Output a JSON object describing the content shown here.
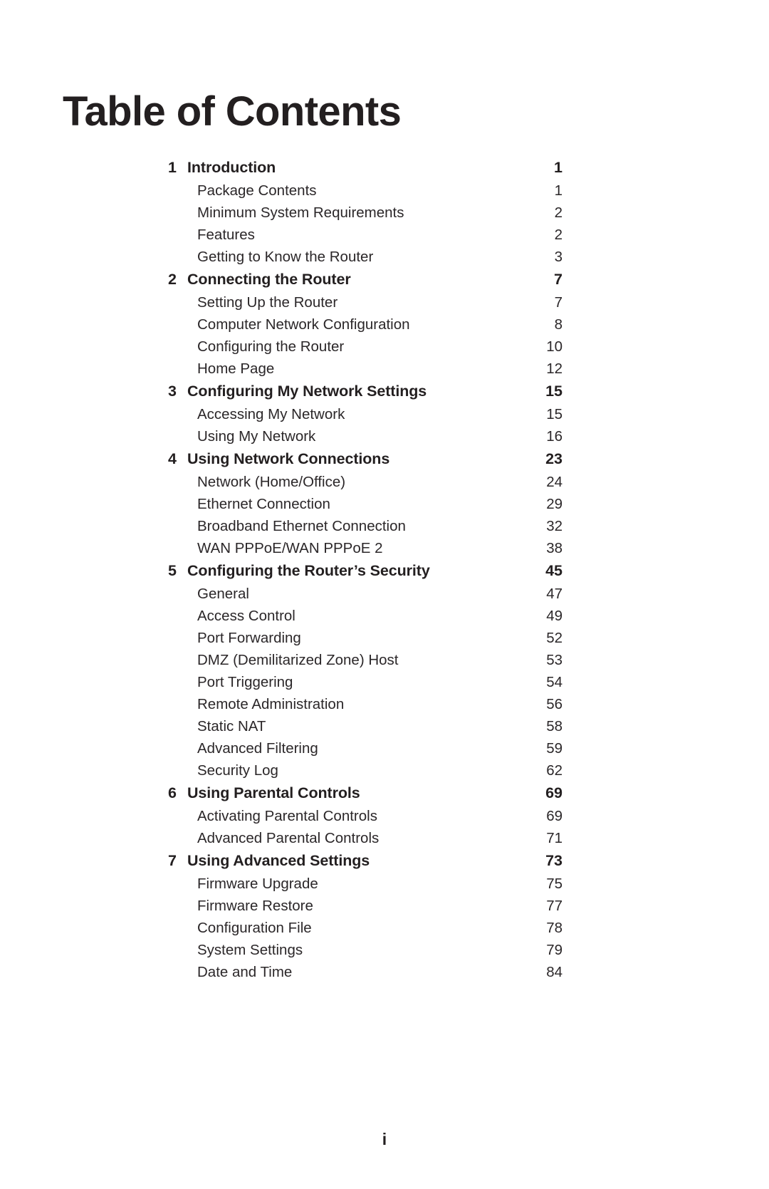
{
  "document": {
    "title": "Table of Contents",
    "folio": "i"
  },
  "toc": {
    "entries": [
      {
        "level": "chapter",
        "number": "1",
        "label": "Introduction",
        "page": "1"
      },
      {
        "level": "section",
        "number": "",
        "label": "Package Contents",
        "page": "1"
      },
      {
        "level": "section",
        "number": "",
        "label": "Minimum System Requirements",
        "page": "2"
      },
      {
        "level": "section",
        "number": "",
        "label": "Features",
        "page": "2"
      },
      {
        "level": "section",
        "number": "",
        "label": "Getting to Know the Router",
        "page": "3"
      },
      {
        "level": "chapter",
        "number": "2",
        "label": "Connecting the Router",
        "page": "7"
      },
      {
        "level": "section",
        "number": "",
        "label": "Setting Up the Router",
        "page": "7"
      },
      {
        "level": "section",
        "number": "",
        "label": "Computer Network Configuration",
        "page": "8"
      },
      {
        "level": "section",
        "number": "",
        "label": "Configuring the Router",
        "page": "10"
      },
      {
        "level": "section",
        "number": "",
        "label": "Home Page",
        "page": "12"
      },
      {
        "level": "chapter",
        "number": "3",
        "label": "Configuring My Network Settings",
        "page": "15"
      },
      {
        "level": "section",
        "number": "",
        "label": "Accessing My Network",
        "page": "15"
      },
      {
        "level": "section",
        "number": "",
        "label": "Using My Network",
        "page": "16"
      },
      {
        "level": "chapter",
        "number": "4",
        "label": "Using Network Connections",
        "page": "23"
      },
      {
        "level": "section",
        "number": "",
        "label": "Network (Home/Office)",
        "page": "24"
      },
      {
        "level": "section",
        "number": "",
        "label": "Ethernet Connection",
        "page": "29"
      },
      {
        "level": "section",
        "number": "",
        "label": "Broadband Ethernet Connection",
        "page": "32"
      },
      {
        "level": "section",
        "number": "",
        "label": "WAN PPPoE/WAN PPPoE 2",
        "page": "38"
      },
      {
        "level": "chapter",
        "number": "5",
        "label": "Configuring the Router’s Security",
        "page": "45"
      },
      {
        "level": "section",
        "number": "",
        "label": "General",
        "page": "47"
      },
      {
        "level": "section",
        "number": "",
        "label": "Access Control",
        "page": "49"
      },
      {
        "level": "section",
        "number": "",
        "label": "Port Forwarding",
        "page": "52"
      },
      {
        "level": "section",
        "number": "",
        "label": "DMZ (Demilitarized Zone) Host",
        "page": "53"
      },
      {
        "level": "section",
        "number": "",
        "label": "Port Triggering",
        "page": "54"
      },
      {
        "level": "section",
        "number": "",
        "label": "Remote Administration",
        "page": "56"
      },
      {
        "level": "section",
        "number": "",
        "label": "Static NAT",
        "page": "58"
      },
      {
        "level": "section",
        "number": "",
        "label": "Advanced Filtering",
        "page": "59"
      },
      {
        "level": "section",
        "number": "",
        "label": "Security Log",
        "page": "62"
      },
      {
        "level": "chapter",
        "number": "6",
        "label": "Using Parental Controls",
        "page": "69"
      },
      {
        "level": "section",
        "number": "",
        "label": "Activating Parental Controls",
        "page": "69"
      },
      {
        "level": "section",
        "number": "",
        "label": "Advanced Parental Controls",
        "page": "71"
      },
      {
        "level": "chapter",
        "number": "7",
        "label": "Using Advanced Settings",
        "page": "73"
      },
      {
        "level": "section",
        "number": "",
        "label": "Firmware Upgrade",
        "page": "75"
      },
      {
        "level": "section",
        "number": "",
        "label": "Firmware Restore",
        "page": "77"
      },
      {
        "level": "section",
        "number": "",
        "label": "Configuration File",
        "page": "78"
      },
      {
        "level": "section",
        "number": "",
        "label": "System Settings",
        "page": "79"
      },
      {
        "level": "section",
        "number": "",
        "label": "Date and Time",
        "page": "84"
      }
    ]
  }
}
